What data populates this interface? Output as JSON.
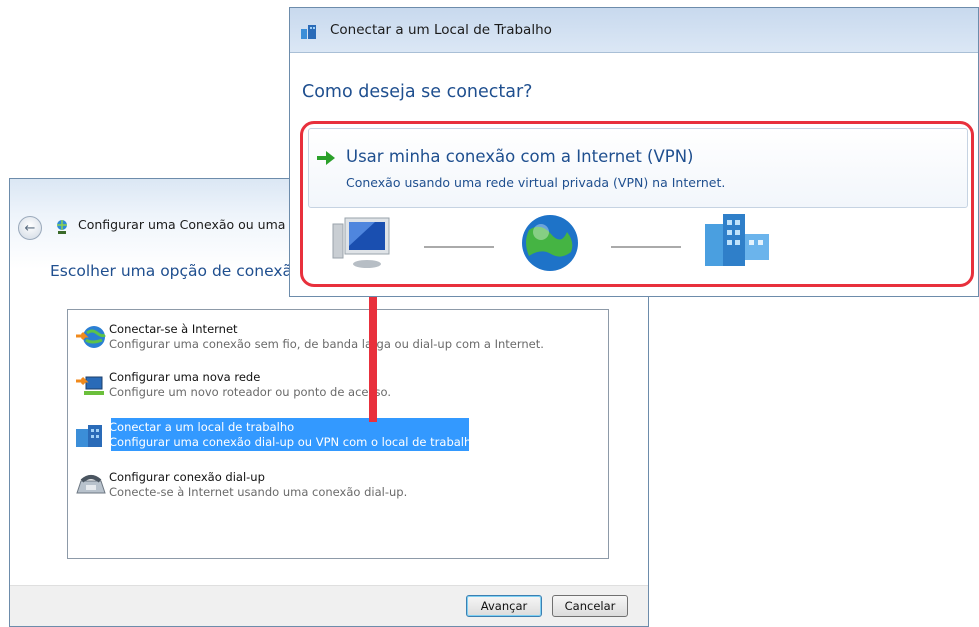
{
  "back_dialog": {
    "title": "Configurar uma Conexão ou uma Rede",
    "heading": "Escolher uma opção de conexão",
    "options": [
      {
        "title": "Conectar-se à Internet",
        "desc": "Configurar uma conexão sem fio, de banda larga ou dial-up com a Internet.",
        "icon": "globe-icon",
        "selected": false
      },
      {
        "title": "Configurar uma nova rede",
        "desc": "Configure um novo roteador ou ponto de acesso.",
        "icon": "network-setup-icon",
        "selected": false
      },
      {
        "title": "Conectar a um local de trabalho",
        "desc": "Configurar uma conexão dial-up ou VPN com o local de trabalho.",
        "icon": "workplace-icon",
        "selected": true
      },
      {
        "title": "Configurar conexão dial-up",
        "desc": "Conecte-se à Internet usando uma conexão dial-up.",
        "icon": "phone-modem-icon",
        "selected": false
      }
    ],
    "next_label": "Avançar",
    "cancel_label": "Cancelar"
  },
  "front_dialog": {
    "title": "Conectar a um Local de Trabalho",
    "question": "Como deseja se conectar?",
    "vpn_option": {
      "title": "Usar minha conexão com a Internet (VPN)",
      "desc": "Conexão usando uma rede virtual privada (VPN) na Internet."
    }
  },
  "colors": {
    "heading_blue": "#1f4f8f",
    "selection_blue": "#3399ff",
    "highlight_red": "#e8303c"
  }
}
